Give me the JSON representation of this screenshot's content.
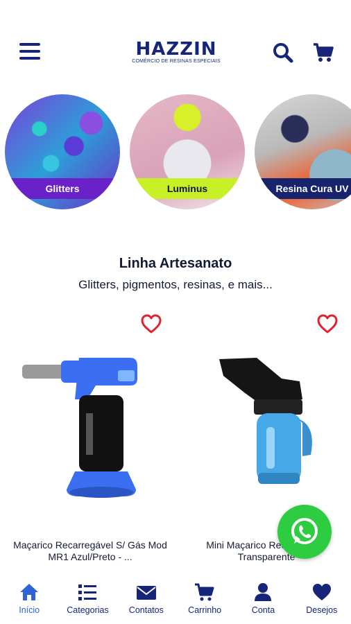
{
  "header": {
    "brand": "HAZZIN",
    "tagline": "COMÉRCIO DE RESINAS ESPECIAIS",
    "icons": {
      "menu": "hamburger-icon",
      "search": "search-icon",
      "cart": "cart-icon"
    }
  },
  "categories": [
    {
      "label": "Glitters"
    },
    {
      "label": "Luminus"
    },
    {
      "label": "Resina Cura UV"
    }
  ],
  "section": {
    "title": "Linha Artesanato",
    "subtitle": "Glitters, pigmentos, resinas, e mais..."
  },
  "products": [
    {
      "name": "Maçarico Recarregável S/ Gás Mod MR1 Azul/Preto - ..."
    },
    {
      "name": "Mini Maçarico Recarregável Transparente"
    }
  ],
  "bottom_nav": [
    {
      "label": "Início",
      "icon": "home-icon"
    },
    {
      "label": "Categorias",
      "icon": "list-icon"
    },
    {
      "label": "Contatos",
      "icon": "mail-icon"
    },
    {
      "label": "Carrinho",
      "icon": "cart-icon"
    },
    {
      "label": "Conta",
      "icon": "user-icon"
    },
    {
      "label": "Desejos",
      "icon": "heart-icon"
    }
  ],
  "colors": {
    "brand_navy": "#16257a",
    "active_blue": "#2f63d6",
    "glitters_purple": "#6a22c8",
    "luminus_lime": "#c8f026",
    "whatsapp_green": "#2ecc40",
    "favorite_red": "#e0212e"
  }
}
